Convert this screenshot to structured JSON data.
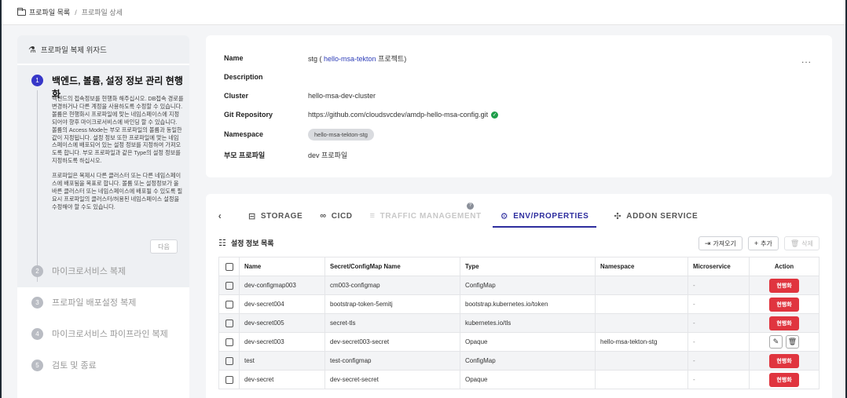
{
  "breadcrumb": {
    "root": "프로파일 목록",
    "separator": "/",
    "current": "프로파일 상세"
  },
  "wizard": {
    "header": "프로파일 복제 위자드",
    "active_step": {
      "number": "1",
      "title": "백엔드, 볼륨, 설정 정보 관리 현행화",
      "desc1": "백엔드의 접속정보를 현행화 해주십시오. DB접속 경로를 변경하거나 다른 계정을 사용하도록 수정할 수 있습니다. 볼륨은 현행화시 프로파일에 맞는 네임스페이스에 지정되어야 향후 마이크로서비스에 바인딩 할 수 있습니다. 볼륨의 Access Mode는 부모 프로파일의 볼륨과 동일한 값이 지정됩니다. 설정 정보 또한 프로파일에 맞는 네임스페이스에 배포되어 있는 설정 정보를 지정하여 가져오도록 합니다. 부모 프로파일과 같은 Type의 설정 정보를 지정하도록 하십시오.",
      "desc2": "프로파일은 복제시 다른 클러스터 또는 다른 네임스페이스에 배포됨을 목표로 합니다. 볼륨 또는 설정정보가 올바른 클러스터 또는 네임스페이스에 배포될 수 있도록 필요시 프로파일의 클러스터/허용된 네임스페이스 설정을 수정해야 할 수도 있습니다.",
      "next": "다음"
    },
    "steps": [
      {
        "number": "2",
        "label": "마이크로서비스 복제"
      },
      {
        "number": "3",
        "label": "프로파일 배포설정 복제"
      },
      {
        "number": "4",
        "label": "마이크로서비스 파이프라인 복제"
      },
      {
        "number": "5",
        "label": "검토 및 종료"
      }
    ]
  },
  "info": {
    "name_label": "Name",
    "name_prefix": "stg (",
    "name_project": "hello-msa-tekton",
    "name_suffix": "프로젝트)",
    "description_label": "Description",
    "cluster_label": "Cluster",
    "cluster": "hello-msa-dev-cluster",
    "git_label": "Git Repository",
    "git": "https://github.com/cloudsvcdev/amdp-hello-msa-config.git",
    "namespace_label": "Namespace",
    "namespace": "hello-msa-tekton-stg",
    "parent_label": "부모 프로파일",
    "parent": "dev 프로파일",
    "more": "..."
  },
  "tabs": [
    {
      "label": "STORAGE",
      "icon": "hard-drive-icon"
    },
    {
      "label": "CICD",
      "icon": "infinity-icon"
    },
    {
      "label": "TRAFFIC MANAGEMENT",
      "icon": "traffic-icon"
    },
    {
      "label": "ENV/PROPERTIES",
      "icon": "gear-icon"
    },
    {
      "label": "ADDON SERVICE",
      "icon": "puzzle-icon"
    }
  ],
  "tab_prev": "‹",
  "tab_help": "?",
  "list": {
    "title": "설정 정보 목록",
    "import": "가져오기",
    "add": "추가",
    "delete": "삭제"
  },
  "table": {
    "headers": [
      "Name",
      "Secret/ConfigMap Name",
      "Type",
      "Namespace",
      "Microservice",
      "Action"
    ],
    "rows": [
      {
        "name": "dev-configmap003",
        "secret": "cm003-configmap",
        "type": "ConfigMap",
        "namespace": "",
        "micro": "-",
        "action": "현행화"
      },
      {
        "name": "dev-secret004",
        "secret": "bootstrap-token-5emitj",
        "type": "bootstrap.kubernetes.io/token",
        "namespace": "",
        "micro": "-",
        "action": "현행화"
      },
      {
        "name": "dev-secret005",
        "secret": "secret-tls",
        "type": "kubernetes.io/tls",
        "namespace": "",
        "micro": "-",
        "action": "현행화"
      },
      {
        "name": "dev-secret003",
        "secret": "dev-secret003-secret",
        "type": "Opaque",
        "namespace": "hello-msa-tekton-stg",
        "micro": "-",
        "action": ""
      },
      {
        "name": "test",
        "secret": "test-configmap",
        "type": "ConfigMap",
        "namespace": "",
        "micro": "-",
        "action": "현행화"
      },
      {
        "name": "dev-secret",
        "secret": "dev-secret-secret",
        "type": "Opaque",
        "namespace": "",
        "micro": "-",
        "action": "현행화"
      }
    ]
  }
}
